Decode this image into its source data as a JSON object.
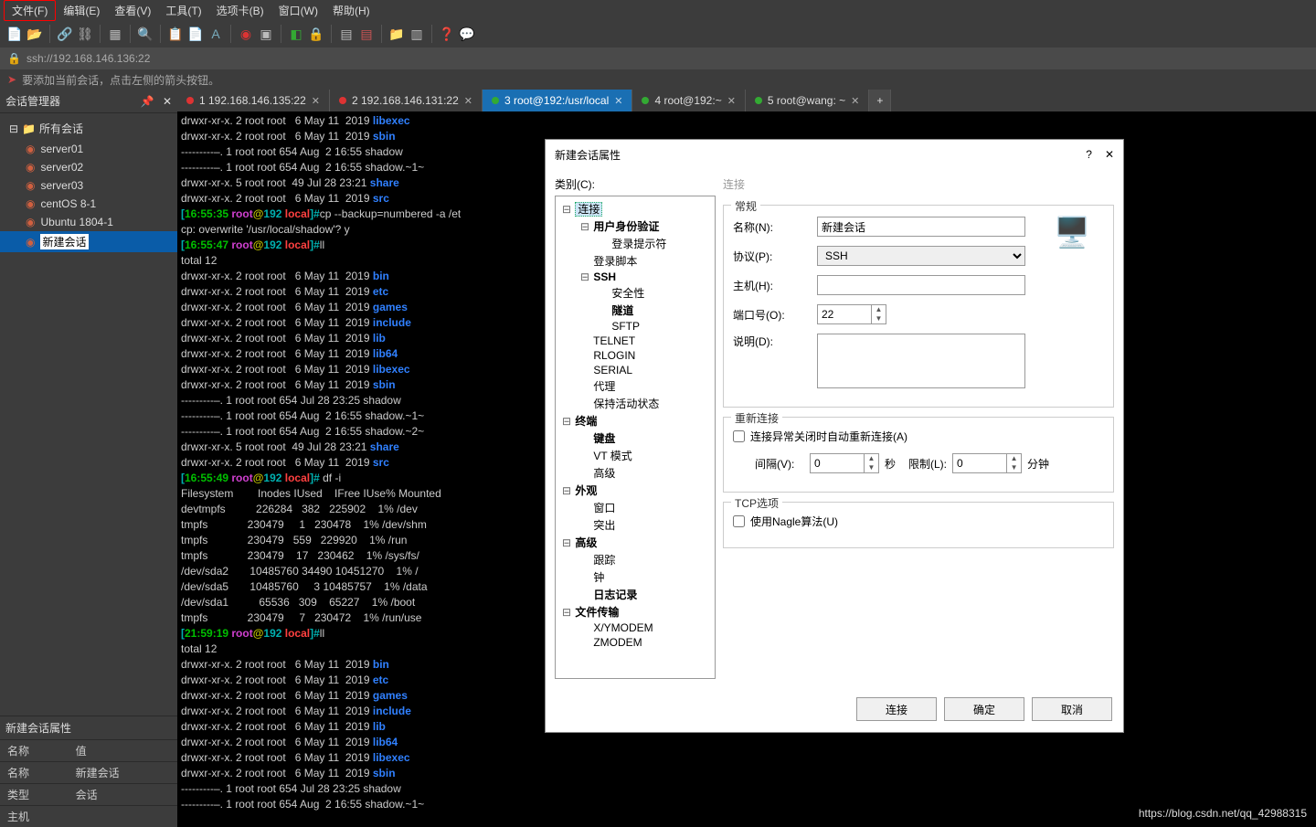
{
  "menu": {
    "file": "文件(F)",
    "edit": "编辑(E)",
    "view": "查看(V)",
    "tools": "工具(T)",
    "options": "选项卡(B)",
    "window": "窗口(W)",
    "help": "帮助(H)"
  },
  "address": "ssh://192.168.146.136:22",
  "infobar_text": "要添加当前会话，点击左侧的箭头按钮。",
  "sidebar": {
    "title": "会话管理器",
    "root": "所有会话",
    "items": [
      "server01",
      "server02",
      "server03",
      "centOS 8-1",
      "Ubuntu 1804-1",
      "新建会话"
    ],
    "props_title": "新建会话属性",
    "props_headers": {
      "name": "名称",
      "value": "值"
    },
    "props": [
      {
        "k": "名称",
        "v": "新建会话"
      },
      {
        "k": "类型",
        "v": "会话"
      },
      {
        "k": "主机",
        "v": ""
      }
    ]
  },
  "tabs": [
    {
      "dot": "red",
      "label": "1 192.168.146.135:22",
      "close": true
    },
    {
      "dot": "red",
      "label": "2 192.168.146.131:22",
      "close": true
    },
    {
      "dot": "green",
      "label": "3 root@192:/usr/local",
      "close": true,
      "active": true
    },
    {
      "dot": "green",
      "label": "4 root@192:~",
      "close": true
    },
    {
      "dot": "green",
      "label": "5 root@wang: ~",
      "close": true
    }
  ],
  "terminal_lines": [
    {
      "segs": [
        {
          "t": "drwxr-xr-x. 2 root root   6 May 11  2019 "
        },
        {
          "t": "libexec",
          "c": "c-blue"
        }
      ]
    },
    {
      "segs": [
        {
          "t": "drwxr-xr-x. 2 root root   6 May 11  2019 "
        },
        {
          "t": "sbin",
          "c": "c-blue"
        }
      ]
    },
    {
      "segs": [
        {
          "t": "---------–. 1 root root 654 Aug  2 16:55 shadow"
        }
      ]
    },
    {
      "segs": [
        {
          "t": "---------–. 1 root root 654 Aug  2 16:55 shadow.~1~"
        }
      ]
    },
    {
      "segs": [
        {
          "t": "drwxr-xr-x. 5 root root  49 Jul 28 23:21 "
        },
        {
          "t": "share",
          "c": "c-blue"
        }
      ]
    },
    {
      "segs": [
        {
          "t": "drwxr-xr-x. 2 root root   6 May 11  2019 "
        },
        {
          "t": "src",
          "c": "c-blue"
        }
      ]
    },
    {
      "segs": [
        {
          "t": "[",
          "c": "c-cyan"
        },
        {
          "t": "16:55:35 ",
          "c": "c-green"
        },
        {
          "t": "root",
          "c": "c-magenta"
        },
        {
          "t": "@",
          "c": "c-yellow"
        },
        {
          "t": "192 ",
          "c": "c-cyan"
        },
        {
          "t": "local",
          "c": "c-red"
        },
        {
          "t": "]#",
          "c": "c-cyan"
        },
        {
          "t": "cp --backup=numbered -a /et"
        }
      ]
    },
    {
      "segs": [
        {
          "t": "cp: overwrite '/usr/local/shadow'? y"
        }
      ]
    },
    {
      "segs": [
        {
          "t": "[",
          "c": "c-cyan"
        },
        {
          "t": "16:55:47 ",
          "c": "c-green"
        },
        {
          "t": "root",
          "c": "c-magenta"
        },
        {
          "t": "@",
          "c": "c-yellow"
        },
        {
          "t": "192 ",
          "c": "c-cyan"
        },
        {
          "t": "local",
          "c": "c-red"
        },
        {
          "t": "]#",
          "c": "c-cyan"
        },
        {
          "t": "ll"
        }
      ]
    },
    {
      "segs": [
        {
          "t": "total 12"
        }
      ]
    },
    {
      "segs": [
        {
          "t": "drwxr-xr-x. 2 root root   6 May 11  2019 "
        },
        {
          "t": "bin",
          "c": "c-blue"
        }
      ]
    },
    {
      "segs": [
        {
          "t": "drwxr-xr-x. 2 root root   6 May 11  2019 "
        },
        {
          "t": "etc",
          "c": "c-blue"
        }
      ]
    },
    {
      "segs": [
        {
          "t": "drwxr-xr-x. 2 root root   6 May 11  2019 "
        },
        {
          "t": "games",
          "c": "c-blue"
        }
      ]
    },
    {
      "segs": [
        {
          "t": "drwxr-xr-x. 2 root root   6 May 11  2019 "
        },
        {
          "t": "include",
          "c": "c-blue"
        }
      ]
    },
    {
      "segs": [
        {
          "t": "drwxr-xr-x. 2 root root   6 May 11  2019 "
        },
        {
          "t": "lib",
          "c": "c-blue"
        }
      ]
    },
    {
      "segs": [
        {
          "t": "drwxr-xr-x. 2 root root   6 May 11  2019 "
        },
        {
          "t": "lib64",
          "c": "c-blue"
        }
      ]
    },
    {
      "segs": [
        {
          "t": "drwxr-xr-x. 2 root root   6 May 11  2019 "
        },
        {
          "t": "libexec",
          "c": "c-blue"
        }
      ]
    },
    {
      "segs": [
        {
          "t": "drwxr-xr-x. 2 root root   6 May 11  2019 "
        },
        {
          "t": "sbin",
          "c": "c-blue"
        }
      ]
    },
    {
      "segs": [
        {
          "t": "---------–. 1 root root 654 Jul 28 23:25 shadow"
        }
      ]
    },
    {
      "segs": [
        {
          "t": "---------–. 1 root root 654 Aug  2 16:55 shadow.~1~"
        }
      ]
    },
    {
      "segs": [
        {
          "t": "---------–. 1 root root 654 Aug  2 16:55 shadow.~2~"
        }
      ]
    },
    {
      "segs": [
        {
          "t": "drwxr-xr-x. 5 root root  49 Jul 28 23:21 "
        },
        {
          "t": "share",
          "c": "c-blue"
        }
      ]
    },
    {
      "segs": [
        {
          "t": "drwxr-xr-x. 2 root root   6 May 11  2019 "
        },
        {
          "t": "src",
          "c": "c-blue"
        }
      ]
    },
    {
      "segs": [
        {
          "t": "[",
          "c": "c-cyan"
        },
        {
          "t": "16:55:49 ",
          "c": "c-green"
        },
        {
          "t": "root",
          "c": "c-magenta"
        },
        {
          "t": "@",
          "c": "c-yellow"
        },
        {
          "t": "192 ",
          "c": "c-cyan"
        },
        {
          "t": "local",
          "c": "c-red"
        },
        {
          "t": "]#",
          "c": "c-cyan"
        },
        {
          "t": " df -i"
        }
      ]
    },
    {
      "segs": [
        {
          "t": "Filesystem        Inodes IUsed    IFree IUse% Mounted "
        }
      ]
    },
    {
      "segs": [
        {
          "t": "devtmpfs          226284   382   225902    1% /dev"
        }
      ]
    },
    {
      "segs": [
        {
          "t": "tmpfs             230479     1   230478    1% /dev/shm"
        }
      ]
    },
    {
      "segs": [
        {
          "t": "tmpfs             230479   559   229920    1% /run"
        }
      ]
    },
    {
      "segs": [
        {
          "t": "tmpfs             230479    17   230462    1% /sys/fs/"
        }
      ]
    },
    {
      "segs": [
        {
          "t": "/dev/sda2       10485760 34490 10451270    1% /"
        }
      ]
    },
    {
      "segs": [
        {
          "t": "/dev/sda5       10485760     3 10485757    1% /data"
        }
      ]
    },
    {
      "segs": [
        {
          "t": "/dev/sda1          65536   309    65227    1% /boot"
        }
      ]
    },
    {
      "segs": [
        {
          "t": "tmpfs             230479     7   230472    1% /run/use"
        }
      ]
    },
    {
      "segs": [
        {
          "t": "[",
          "c": "c-cyan"
        },
        {
          "t": "21:59:19 ",
          "c": "c-green"
        },
        {
          "t": "root",
          "c": "c-magenta"
        },
        {
          "t": "@",
          "c": "c-yellow"
        },
        {
          "t": "192 ",
          "c": "c-cyan"
        },
        {
          "t": "local",
          "c": "c-red"
        },
        {
          "t": "]#",
          "c": "c-cyan"
        },
        {
          "t": "ll"
        }
      ]
    },
    {
      "segs": [
        {
          "t": "total 12"
        }
      ]
    },
    {
      "segs": [
        {
          "t": "drwxr-xr-x. 2 root root   6 May 11  2019 "
        },
        {
          "t": "bin",
          "c": "c-blue"
        }
      ]
    },
    {
      "segs": [
        {
          "t": "drwxr-xr-x. 2 root root   6 May 11  2019 "
        },
        {
          "t": "etc",
          "c": "c-blue"
        }
      ]
    },
    {
      "segs": [
        {
          "t": "drwxr-xr-x. 2 root root   6 May 11  2019 "
        },
        {
          "t": "games",
          "c": "c-blue"
        }
      ]
    },
    {
      "segs": [
        {
          "t": "drwxr-xr-x. 2 root root   6 May 11  2019 "
        },
        {
          "t": "include",
          "c": "c-blue"
        }
      ]
    },
    {
      "segs": [
        {
          "t": "drwxr-xr-x. 2 root root   6 May 11  2019 "
        },
        {
          "t": "lib",
          "c": "c-blue"
        }
      ]
    },
    {
      "segs": [
        {
          "t": "drwxr-xr-x. 2 root root   6 May 11  2019 "
        },
        {
          "t": "lib64",
          "c": "c-blue"
        }
      ]
    },
    {
      "segs": [
        {
          "t": "drwxr-xr-x. 2 root root   6 May 11  2019 "
        },
        {
          "t": "libexec",
          "c": "c-blue"
        }
      ]
    },
    {
      "segs": [
        {
          "t": "drwxr-xr-x. 2 root root   6 May 11  2019 "
        },
        {
          "t": "sbin",
          "c": "c-blue"
        }
      ]
    },
    {
      "segs": [
        {
          "t": "---------–. 1 root root 654 Jul 28 23:25 shadow"
        }
      ]
    },
    {
      "segs": [
        {
          "t": "---------–. 1 root root 654 Aug  2 16:55 shadow.~1~"
        }
      ]
    }
  ],
  "modal": {
    "title": "新建会话属性",
    "category_label": "类别(C):",
    "right_title": "连接",
    "tree": [
      {
        "lvl": 1,
        "lbl": "连接",
        "sel": true,
        "toggle": "−"
      },
      {
        "lvl": 2,
        "lbl": "用户身份验证",
        "toggle": "−",
        "bold": true
      },
      {
        "lvl": 3,
        "lbl": "登录提示符"
      },
      {
        "lvl": 2,
        "lbl": "登录脚本"
      },
      {
        "lvl": 2,
        "lbl": "SSH",
        "toggle": "−",
        "bold": true
      },
      {
        "lvl": 3,
        "lbl": "安全性"
      },
      {
        "lvl": 3,
        "lbl": "隧道",
        "bold": true
      },
      {
        "lvl": 3,
        "lbl": "SFTP"
      },
      {
        "lvl": 2,
        "lbl": "TELNET"
      },
      {
        "lvl": 2,
        "lbl": "RLOGIN"
      },
      {
        "lvl": 2,
        "lbl": "SERIAL"
      },
      {
        "lvl": 2,
        "lbl": "代理"
      },
      {
        "lvl": 2,
        "lbl": "保持活动状态"
      },
      {
        "lvl": 1,
        "lbl": "终端",
        "toggle": "−",
        "bold": true
      },
      {
        "lvl": 2,
        "lbl": "键盘",
        "bold": true
      },
      {
        "lvl": 2,
        "lbl": "VT 模式"
      },
      {
        "lvl": 2,
        "lbl": "高级"
      },
      {
        "lvl": 1,
        "lbl": "外观",
        "toggle": "−",
        "bold": true
      },
      {
        "lvl": 2,
        "lbl": "窗口"
      },
      {
        "lvl": 2,
        "lbl": "突出"
      },
      {
        "lvl": 1,
        "lbl": "高级",
        "toggle": "−",
        "bold": true
      },
      {
        "lvl": 2,
        "lbl": "跟踪"
      },
      {
        "lvl": 2,
        "lbl": "钟"
      },
      {
        "lvl": 2,
        "lbl": "日志记录",
        "bold": true
      },
      {
        "lvl": 1,
        "lbl": "文件传输",
        "toggle": "−",
        "bold": true
      },
      {
        "lvl": 2,
        "lbl": "X/YMODEM"
      },
      {
        "lvl": 2,
        "lbl": "ZMODEM"
      }
    ],
    "general": {
      "legend": "常规",
      "name_label": "名称(N):",
      "name_value": "新建会话",
      "proto_label": "协议(P):",
      "proto_value": "SSH",
      "host_label": "主机(H):",
      "host_value": "",
      "port_label": "端口号(O):",
      "port_value": "22",
      "desc_label": "说明(D):"
    },
    "reconnect": {
      "legend": "重新连接",
      "chk_label": "连接异常关闭时自动重新连接(A)",
      "interval_label": "间隔(V):",
      "interval_value": "0",
      "interval_unit": "秒",
      "limit_label": "限制(L):",
      "limit_value": "0",
      "limit_unit": "分钟"
    },
    "tcp": {
      "legend": "TCP选项",
      "chk_label": "使用Nagle算法(U)"
    },
    "buttons": {
      "connect": "连接",
      "ok": "确定",
      "cancel": "取消"
    }
  },
  "watermark": "https://blog.csdn.net/qq_42988315"
}
